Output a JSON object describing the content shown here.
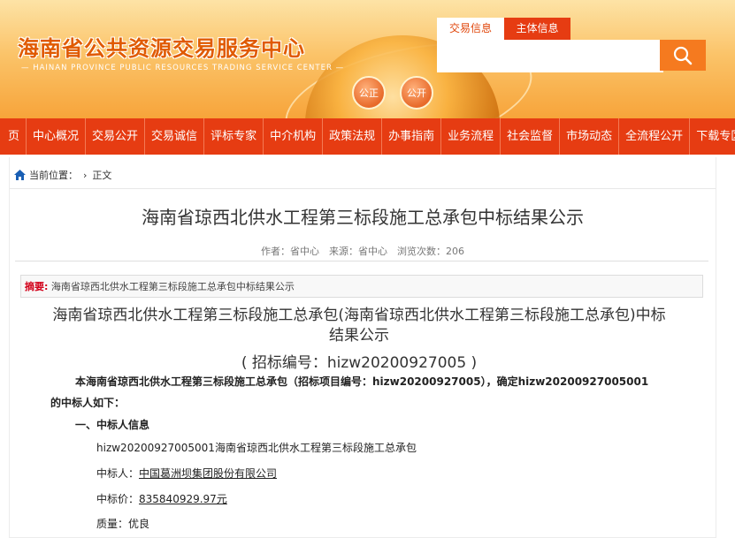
{
  "header": {
    "title": "海南省公共资源交易服务中心",
    "subtitle": "HAINAN PROVINCE PUBLIC RESOURCES TRADING SERVICE CENTER",
    "badge_left": "公正",
    "badge_right": "公开",
    "search_tabs": [
      "交易信息",
      "主体信息"
    ],
    "search_placeholder": ""
  },
  "nav": {
    "items": [
      "页",
      "中心概况",
      "交易公开",
      "交易诚信",
      "评标专家",
      "中介机构",
      "政策法规",
      "办事指南",
      "业务流程",
      "社会监督",
      "市场动态",
      "全流程公开",
      "下载专区"
    ]
  },
  "breadcrumb": {
    "label": "当前位置：",
    "current": "正文"
  },
  "article": {
    "title": "海南省琼西北供水工程第三标段施工总承包中标结果公示",
    "meta": "作者：省中心　来源：省中心　浏览次数：206",
    "summary_label": "摘要:",
    "summary_text": "海南省琼西北供水工程第三标段施工总承包中标结果公示"
  },
  "document": {
    "title": "海南省琼西北供水工程第三标段施工总承包(海南省琼西北供水工程第三标段施工总承包)中标结果公示",
    "code": "( 招标编号：hizw20200927005 )",
    "intro_1": "本海南省琼西北供水工程第三标段施工总承包（招标项目编号：hizw20200927005），确定hizw20200927005001",
    "intro_2": "的中标人如下：",
    "section_1": "一、中标人信息",
    "package": "hizw20200927005001海南省琼西北供水工程第三标段施工总承包",
    "winner_label": "中标人：",
    "winner": "中国葛洲坝集团股份有限公司",
    "price_label": "中标价：",
    "price": "835840929.97元",
    "quality_label": "质量：",
    "quality": "优良"
  },
  "colors": {
    "brand_orange": "#e63c12",
    "header_gold": "#f7a43a",
    "summary_red": "#d2001a"
  }
}
